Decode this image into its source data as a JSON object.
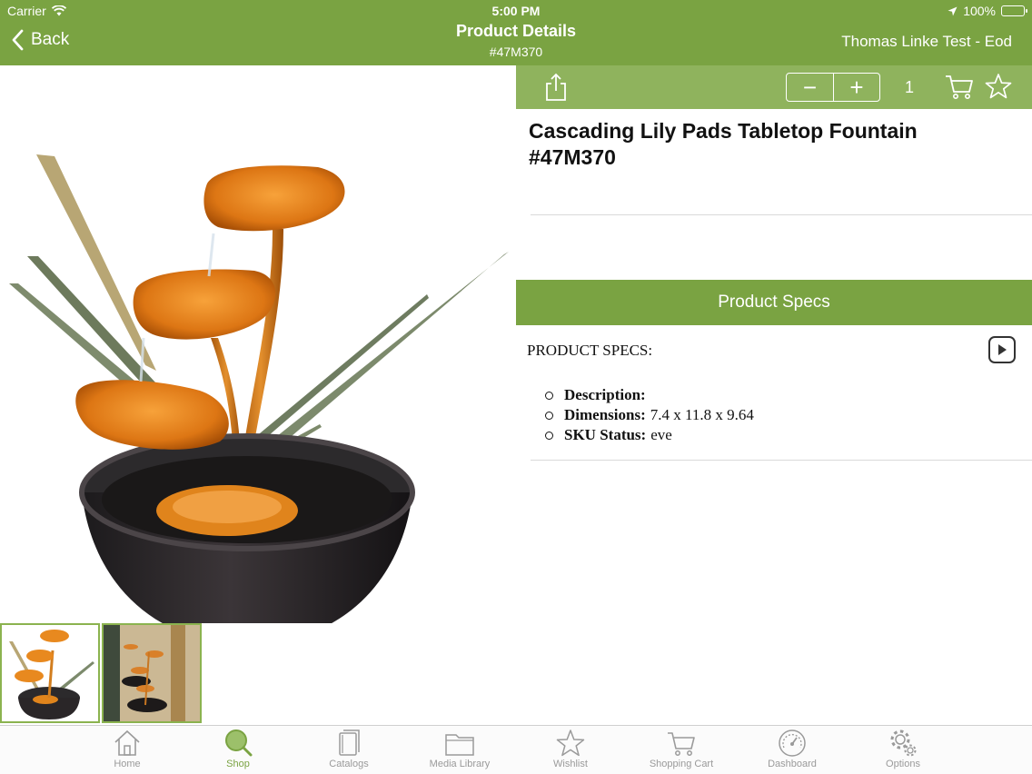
{
  "status_bar": {
    "carrier": "Carrier",
    "time": "5:00 PM",
    "battery": "100%"
  },
  "nav": {
    "back_label": "Back",
    "title": "Product Details",
    "subtitle": "#47M370",
    "user": "Thomas Linke Test - Eod"
  },
  "toolbar": {
    "decrement": "−",
    "increment": "+",
    "quantity": "1"
  },
  "product": {
    "title": "Cascading Lily Pads Tabletop Fountain #47M370"
  },
  "specs": {
    "bar_label": "Product Specs",
    "heading": "PRODUCT SPECS:",
    "items": [
      {
        "label": "Description:",
        "value": ""
      },
      {
        "label": "Dimensions:",
        "value": "7.4 x 11.8 x 9.64"
      },
      {
        "label": "SKU Status:",
        "value": "eve"
      }
    ]
  },
  "tabs": [
    {
      "label": "Home",
      "icon": "home-icon",
      "active": false
    },
    {
      "label": "Shop",
      "icon": "search-icon",
      "active": true
    },
    {
      "label": "Catalogs",
      "icon": "catalogs-icon",
      "active": false
    },
    {
      "label": "Media Library",
      "icon": "folder-icon",
      "active": false
    },
    {
      "label": "Wishlist",
      "icon": "star-icon",
      "active": false
    },
    {
      "label": "Shopping Cart",
      "icon": "cart-icon",
      "active": false
    },
    {
      "label": "Dashboard",
      "icon": "gauge-icon",
      "active": false
    },
    {
      "label": "Options",
      "icon": "gear-icon",
      "active": false
    }
  ],
  "colors": {
    "header_green": "#7aa342",
    "toolbar_green": "#8fb35d",
    "active_tab": "#7aa342",
    "inactive_tab": "#9a9a9a"
  }
}
